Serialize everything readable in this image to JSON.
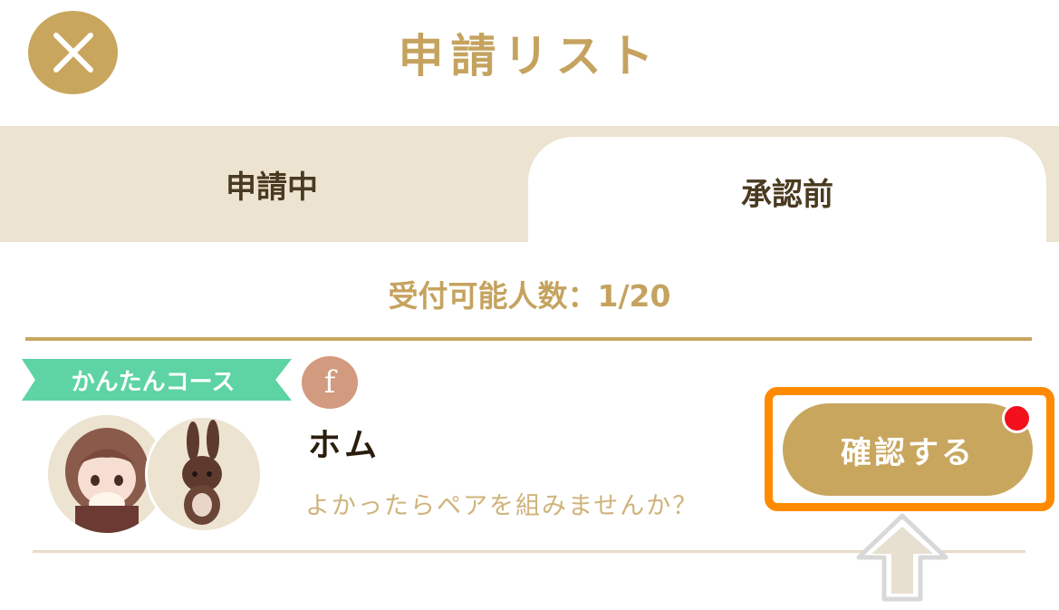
{
  "header": {
    "title": "申請リスト",
    "close_icon": "close-icon"
  },
  "tabs": [
    {
      "label": "申請中",
      "active": false
    },
    {
      "label": "承認前",
      "active": true
    }
  ],
  "capacity": {
    "text": "受付可能人数：1/20"
  },
  "entry": {
    "course_tag": "かんたんコース",
    "badge": "f",
    "name": "ホム",
    "message": "よかったらペアを組みませんか？",
    "confirm_label": "確認する",
    "has_notification": true
  },
  "colors": {
    "accent": "#c8a65e",
    "tab_background": "#ede3d1",
    "course_tag": "#5ed3a3",
    "badge": "#d29a7e",
    "highlight": "#ff8a00",
    "notification": "#f2101c"
  }
}
